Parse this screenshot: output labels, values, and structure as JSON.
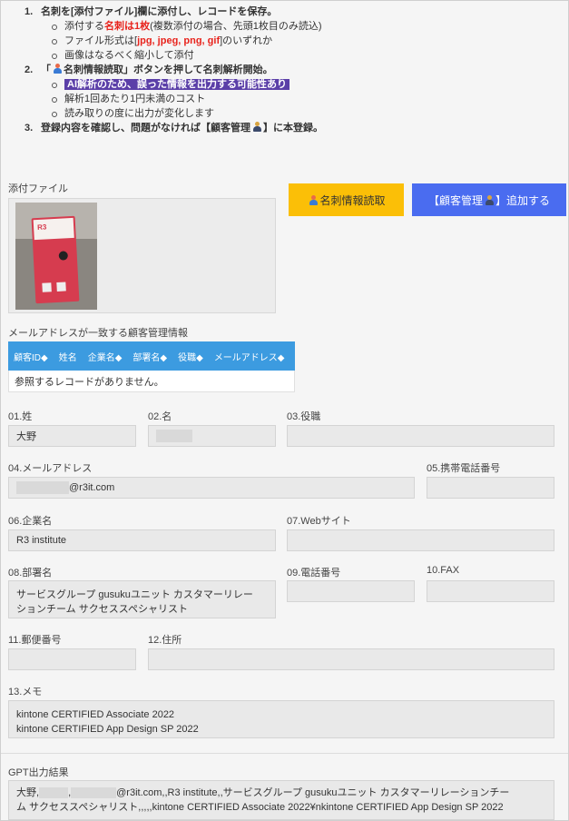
{
  "instructions": {
    "step1": {
      "num": "1.",
      "text": "名刺を[添付ファイル]欄に添付し、レコードを保存。",
      "sub1_a": "添付する",
      "sub1_b": "名刺は1枚",
      "sub1_c": "(複数添付の場合、先頭1枚目のみ読込)",
      "sub2_a": "ファイル形式は[",
      "sub2_b": "jpg, jpeg, png, gif",
      "sub2_c": "]のいずれか",
      "sub3": "画像はなるべく縮小して添付"
    },
    "step2": {
      "num": "2.",
      "text_a": "「",
      "text_b": "名刺情報読取」ボタンを押して名刺解析開始。",
      "sub1": "AI解析のため、誤った情報を出力する可能性あり",
      "sub2": "解析1回あたり1円未満のコスト",
      "sub3": "読み取りの度に出力が変化します"
    },
    "step3": {
      "num": "3.",
      "text_a": "登録内容を確認し、問題がなければ【顧客管理",
      "text_b": "】に本登録。"
    }
  },
  "attachment": {
    "label": "添付ファイル",
    "card_logo": "R3"
  },
  "buttons": {
    "read_card": "名刺情報読取",
    "add_customer_a": "【顧客管理",
    "add_customer_b": "】追加する"
  },
  "related": {
    "label": "メールアドレスが一致する顧客管理情報",
    "columns": [
      "顧客ID◆",
      "姓名",
      "企業名◆",
      "部署名◆",
      "役職◆",
      "メールアドレス◆"
    ],
    "empty": "参照するレコードがありません。"
  },
  "fields": {
    "last_name": {
      "label": "01.姓",
      "value": "大野"
    },
    "first_name": {
      "label": "02.名",
      "value": ""
    },
    "title": {
      "label": "03.役職",
      "value": ""
    },
    "email": {
      "label": "04.メールアドレス",
      "value": "@r3it.com"
    },
    "mobile": {
      "label": "05.携帯電話番号",
      "value": ""
    },
    "company": {
      "label": "06.企業名",
      "value": "R3 institute"
    },
    "website": {
      "label": "07.Webサイト",
      "value": ""
    },
    "department": {
      "label": "08.部署名",
      "line1": "サービスグループ gusukuユニット カスタマーリレー",
      "line2": "ションチーム サクセススペシャリスト"
    },
    "phone": {
      "label": "09.電話番号",
      "value": ""
    },
    "fax": {
      "label": "10.FAX",
      "value": ""
    },
    "zip": {
      "label": "11.郵便番号",
      "value": ""
    },
    "address": {
      "label": "12.住所",
      "value": ""
    },
    "memo": {
      "label": "13.メモ",
      "line1": "kintone CERTIFIED Associate 2022",
      "line2": "kintone CERTIFIED App Design SP 2022"
    }
  },
  "gpt": {
    "label": "GPT出力結果",
    "line1_a": "大野,",
    "line1_b": ",",
    "line1_c": "@r3it.com,,R3 institute,,サービスグループ gusukuユニット カスタマーリレーションチー",
    "line2": "ム サクセススペシャリスト,,,,,kintone CERTIFIED Associate 2022¥nkintone CERTIFIED App Design SP 2022"
  },
  "colors": {
    "yellow_button": "#fbbf07",
    "blue_button": "#4a6cf0",
    "table_header": "#3c9be0",
    "highlight": "#5b3fa8",
    "red_text": "#e8231c"
  }
}
